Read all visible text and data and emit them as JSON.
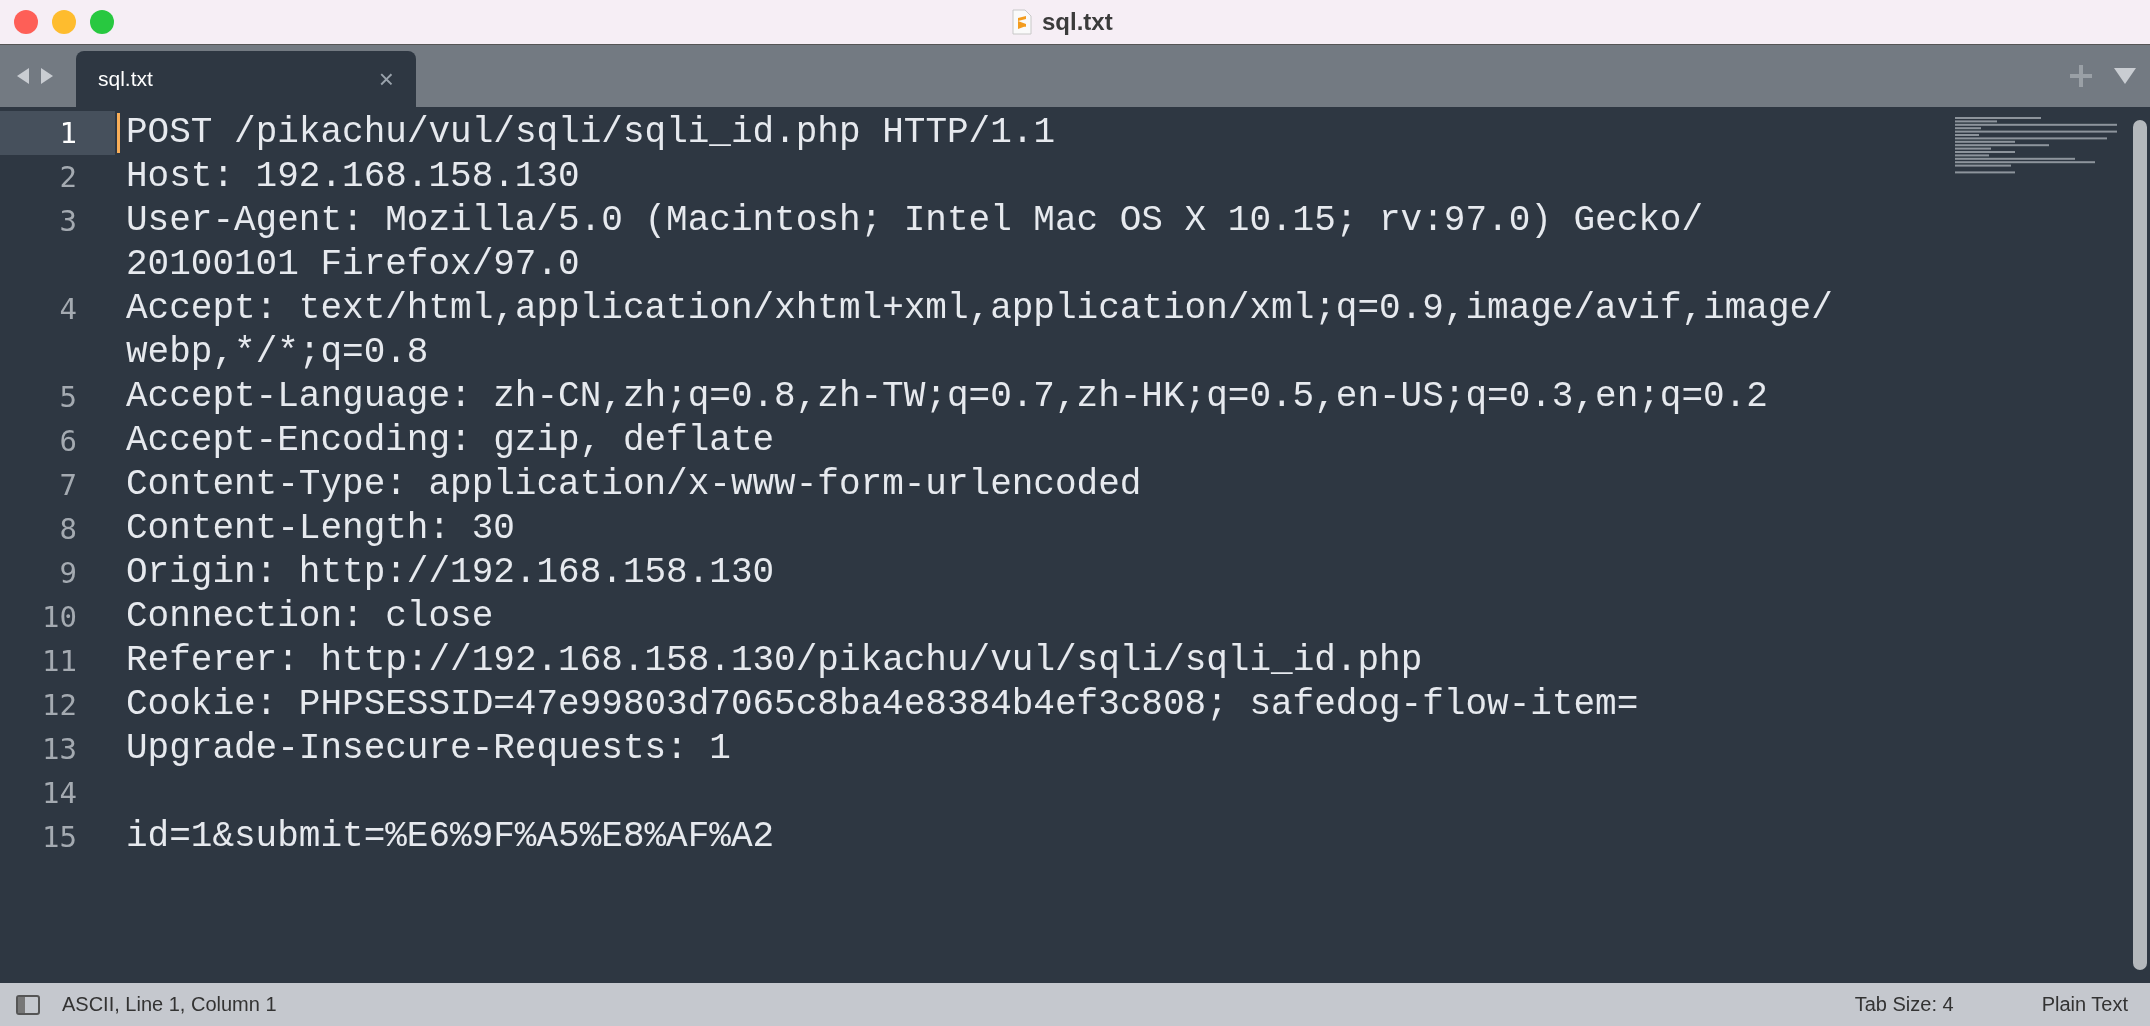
{
  "window": {
    "title": "sql.txt"
  },
  "tabs": [
    {
      "label": "sql.txt",
      "selected": true,
      "close": "×"
    }
  ],
  "editor": {
    "lines": [
      {
        "number": "1",
        "text": "POST /pikachu/vul/sqli/sqli_id.php HTTP/1.1",
        "current": true
      },
      {
        "number": "2",
        "text": "Host: 192.168.158.130",
        "current": false
      },
      {
        "number": "3",
        "text": "User-Agent: Mozilla/5.0 (Macintosh; Intel Mac OS X 10.15; rv:97.0) Gecko/20100101 Firefox/97.0",
        "current": false
      },
      {
        "number": "4",
        "text": "Accept: text/html,application/xhtml+xml,application/xml;q=0.9,image/avif,image/webp,*/*;q=0.8",
        "current": false
      },
      {
        "number": "5",
        "text": "Accept-Language: zh-CN,zh;q=0.8,zh-TW;q=0.7,zh-HK;q=0.5,en-US;q=0.3,en;q=0.2",
        "current": false
      },
      {
        "number": "6",
        "text": "Accept-Encoding: gzip, deflate",
        "current": false
      },
      {
        "number": "7",
        "text": "Content-Type: application/x-www-form-urlencoded",
        "current": false
      },
      {
        "number": "8",
        "text": "Content-Length: 30",
        "current": false
      },
      {
        "number": "9",
        "text": "Origin: http://192.168.158.130",
        "current": false
      },
      {
        "number": "10",
        "text": "Connection: close",
        "current": false
      },
      {
        "number": "11",
        "text": "Referer: http://192.168.158.130/pikachu/vul/sqli/sqli_id.php",
        "current": false
      },
      {
        "number": "12",
        "text": "Cookie: PHPSESSID=47e99803d7065c8ba4e8384b4ef3c808; safedog-flow-item=",
        "current": false
      },
      {
        "number": "13",
        "text": "Upgrade-Insecure-Requests: 1",
        "current": false
      },
      {
        "number": "14",
        "current": false
      },
      {
        "number": "15",
        "text": "id=1&submit=%E6%9F%A5%E8%AF%A2",
        "current": false
      }
    ]
  },
  "status_bar": {
    "position": "ASCII, Line 1, Column 1",
    "tab_size": "Tab Size: 4",
    "syntax": "Plain Text"
  }
}
